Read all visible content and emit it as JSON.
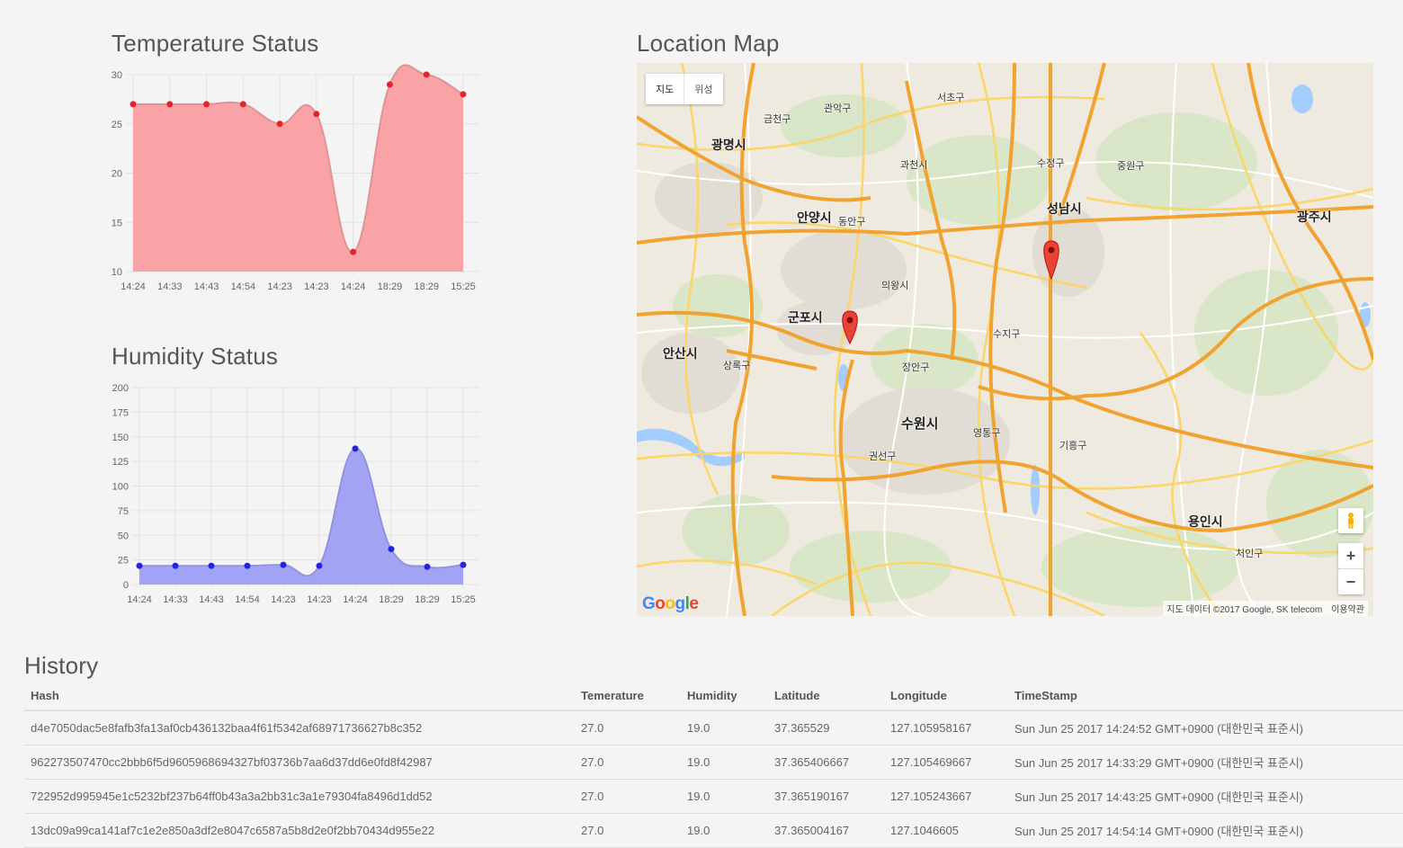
{
  "temperature": {
    "title": "Temperature Status",
    "chart_data": {
      "type": "area",
      "categories": [
        "14:24",
        "14:33",
        "14:43",
        "14:54",
        "14:23",
        "14:23",
        "14:24",
        "18:29",
        "18:29",
        "15:25"
      ],
      "values": [
        27,
        27,
        27,
        27,
        25,
        26,
        12,
        29,
        30,
        28
      ],
      "ylim": [
        10,
        30
      ],
      "yticks": [
        10,
        15,
        20,
        25,
        30
      ],
      "grid": true,
      "fill_color": "#f9a3a6",
      "point_color": "#e6222a"
    }
  },
  "humidity": {
    "title": "Humidity Status",
    "chart_data": {
      "type": "area",
      "categories": [
        "14:24",
        "14:33",
        "14:43",
        "14:54",
        "14:23",
        "14:23",
        "14:24",
        "18:29",
        "18:29",
        "15:25"
      ],
      "values": [
        19,
        19,
        19,
        19,
        20,
        19,
        138,
        36,
        18,
        20
      ],
      "ylim": [
        0,
        200
      ],
      "yticks": [
        0,
        25,
        50,
        75,
        100,
        125,
        150,
        175,
        200
      ],
      "grid": true,
      "fill_color": "#a3a3f5",
      "point_color": "#2323e0"
    }
  },
  "map": {
    "title": "Location Map",
    "type_map": "지도",
    "type_satellite": "위성",
    "labels": {
      "geumcheon": "금천구",
      "gwanak": "관악구",
      "seocho": "서초구",
      "gwangmyeong": "광명시",
      "gwacheon": "과천시",
      "sujeong": "수정구",
      "jungwon": "중원구",
      "seongnam": "성남시",
      "gwangju": "광주시",
      "anyang": "안양시",
      "dongan": "동안구",
      "uiwang": "의왕시",
      "gunpo": "군포시",
      "suji": "수지구",
      "ansan": "안산시",
      "sangnok": "상록구",
      "jangan": "장안구",
      "suwon": "수원시",
      "yeongtong": "영통구",
      "giheung": "기흥구",
      "gwonseon": "권선구",
      "yongin": "용인시",
      "cheoin": "처인구"
    },
    "google": [
      "G",
      "o",
      "o",
      "g",
      "l",
      "e"
    ],
    "attribution": "지도 데이터 ©2017 Google, SK telecom",
    "terms": "이용약관",
    "zoom_in": "+",
    "zoom_out": "−",
    "pegman_icon": "pegman-icon",
    "marker_icon": "map-marker-icon"
  },
  "history": {
    "title": "History",
    "columns": [
      "Hash",
      "Temerature",
      "Humidity",
      "Latitude",
      "Longitude",
      "TimeStamp"
    ],
    "rows": [
      [
        "d4e7050dac5e8fafb3fa13af0cb436132baa4f61f5342af68971736627b8c352",
        "27.0",
        "19.0",
        "37.365529",
        "127.105958167",
        "Sun Jun 25 2017 14:24:52 GMT+0900 (대한민국 표준시)"
      ],
      [
        "962273507470cc2bbb6f5d9605968694327bf03736b7aa6d37dd6e0fd8f42987",
        "27.0",
        "19.0",
        "37.365406667",
        "127.105469667",
        "Sun Jun 25 2017 14:33:29 GMT+0900 (대한민국 표준시)"
      ],
      [
        "722952d995945e1c5232bf237b64ff0b43a3a2bb31c3a1e79304fa8496d1dd52",
        "27.0",
        "19.0",
        "37.365190167",
        "127.105243667",
        "Sun Jun 25 2017 14:43:25 GMT+0900 (대한민국 표준시)"
      ],
      [
        "13dc09a99ca141af7c1e2e850a3df2e8047c6587a5b8d2e0f2bb70434d955e22",
        "27.0",
        "19.0",
        "37.365004167",
        "127.1046605",
        "Sun Jun 25 2017 14:54:14 GMT+0900 (대한민국 표준시)"
      ]
    ]
  }
}
